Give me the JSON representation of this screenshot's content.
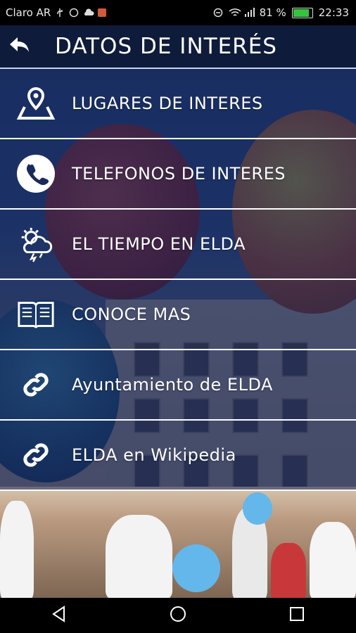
{
  "statusbar": {
    "carrier": "Claro AR",
    "battery_percent": "81 %",
    "time": "22:33"
  },
  "header": {
    "title": "DATOS DE INTERÉS"
  },
  "menu": {
    "items": [
      {
        "label": "LUGARES DE INTERES",
        "icon": "map-pin-icon"
      },
      {
        "label": "TELEFONOS DE INTERES",
        "icon": "phone-icon"
      },
      {
        "label": "EL TIEMPO EN ELDA",
        "icon": "weather-icon"
      },
      {
        "label": "CONOCE MAS",
        "icon": "book-icon"
      },
      {
        "label": "Ayuntamiento de ELDA",
        "icon": "link-icon"
      },
      {
        "label": "ELDA en Wikipedia",
        "icon": "link-icon"
      }
    ]
  },
  "colors": {
    "header_bg": "#0f1b3a",
    "item_overlay": "#142355",
    "text": "#ffffff"
  }
}
